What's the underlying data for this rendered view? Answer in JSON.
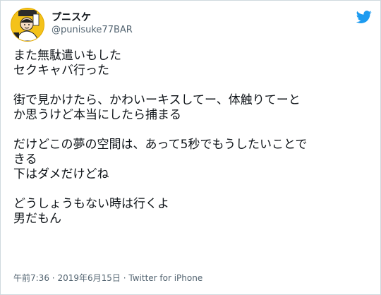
{
  "tweet": {
    "display_name": "プニスケ",
    "handle": "@punisuke77BAR",
    "lines": [
      "また無駄遣いもした",
      "セクキャバ行った",
      "",
      "街で見かけたら、かわいーキスしてー、体触りてーと",
      "か思うけど本当にしたら捕まる",
      "",
      "だけどこの夢の空間は、あって5秒でもうしたいことで",
      "きる",
      "下はダメだけどね",
      "",
      "どうしょうもない時は行くよ",
      "男だもん"
    ],
    "time": "午前7:36",
    "separator": "·",
    "date": "2019年6月15日",
    "source": "Twitter for iPhone"
  },
  "icons": {
    "logo": "twitter-bird-icon",
    "avatar": "avatar-illustration"
  },
  "colors": {
    "text": "#0f1419",
    "secondary": "#536471",
    "twitter_blue": "#1d9bf0",
    "border": "#cfd9de"
  }
}
